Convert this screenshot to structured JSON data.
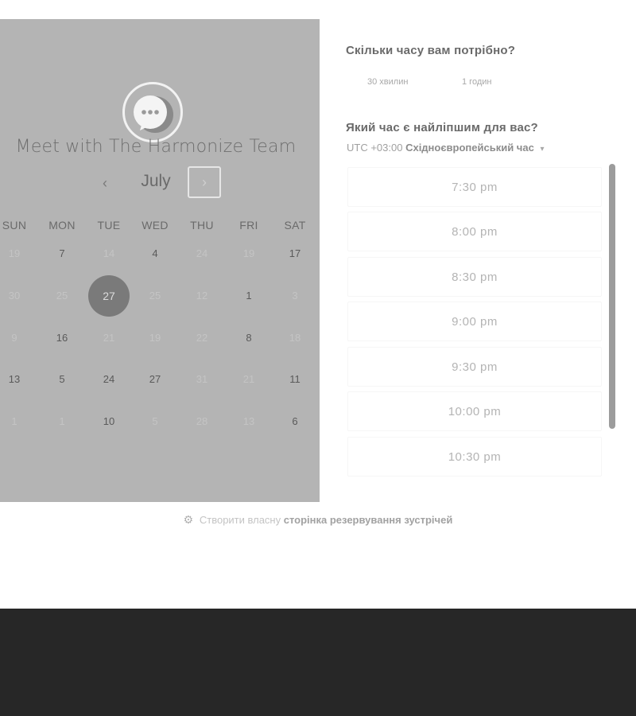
{
  "calendar": {
    "title": "Meet with The Harmonize Team",
    "month": "July",
    "prev_icon": "‹",
    "next_icon": "›",
    "weekdays": [
      "SUN",
      "MON",
      "TUE",
      "WED",
      "THU",
      "FRI",
      "SAT"
    ],
    "weeks": [
      [
        {
          "d": "19",
          "s": "muted"
        },
        {
          "d": "7",
          "s": "avail"
        },
        {
          "d": "14",
          "s": "muted"
        },
        {
          "d": "4",
          "s": "avail"
        },
        {
          "d": "24",
          "s": "muted"
        },
        {
          "d": "19",
          "s": "muted"
        },
        {
          "d": "17",
          "s": "avail"
        }
      ],
      [
        {
          "d": "30",
          "s": "muted"
        },
        {
          "d": "25",
          "s": "muted"
        },
        {
          "d": "27",
          "s": "selected"
        },
        {
          "d": "25",
          "s": "muted"
        },
        {
          "d": "12",
          "s": "muted"
        },
        {
          "d": "1",
          "s": "avail"
        },
        {
          "d": "3",
          "s": "muted"
        }
      ],
      [
        {
          "d": "9",
          "s": "muted"
        },
        {
          "d": "16",
          "s": "avail"
        },
        {
          "d": "21",
          "s": "muted"
        },
        {
          "d": "19",
          "s": "muted"
        },
        {
          "d": "22",
          "s": "muted"
        },
        {
          "d": "8",
          "s": "avail"
        },
        {
          "d": "18",
          "s": "muted"
        }
      ],
      [
        {
          "d": "13",
          "s": "avail"
        },
        {
          "d": "5",
          "s": "avail"
        },
        {
          "d": "24",
          "s": "avail"
        },
        {
          "d": "27",
          "s": "avail"
        },
        {
          "d": "31",
          "s": "muted"
        },
        {
          "d": "21",
          "s": "muted"
        },
        {
          "d": "11",
          "s": "avail"
        }
      ],
      [
        {
          "d": "1",
          "s": "muted"
        },
        {
          "d": "1",
          "s": "muted"
        },
        {
          "d": "10",
          "s": "avail"
        },
        {
          "d": "5",
          "s": "muted"
        },
        {
          "d": "28",
          "s": "muted"
        },
        {
          "d": "13",
          "s": "muted"
        },
        {
          "d": "6",
          "s": "avail"
        }
      ]
    ]
  },
  "duration": {
    "question": "Скільки часу вам потрібно?",
    "options": [
      "30 хвилин",
      "1 годин"
    ]
  },
  "time": {
    "question": "Який час є найліпшим для вас?",
    "tz_prefix": "UTC +03:00",
    "tz_name": "Східноєвропейський час",
    "tz_caret": "▾",
    "slots": [
      "7:30 pm",
      "8:00 pm",
      "8:30 pm",
      "9:00 pm",
      "9:30 pm",
      "10:00 pm",
      "10:30 pm"
    ]
  },
  "footer": {
    "icon": "sprocket-icon",
    "text_plain": "Створити власну",
    "text_bold": "сторінка резервування зустрічей"
  },
  "colors": {
    "panel_bg": "#b4b4b4",
    "selected_day": "#7a7a7a",
    "dark_band": "#272727"
  }
}
